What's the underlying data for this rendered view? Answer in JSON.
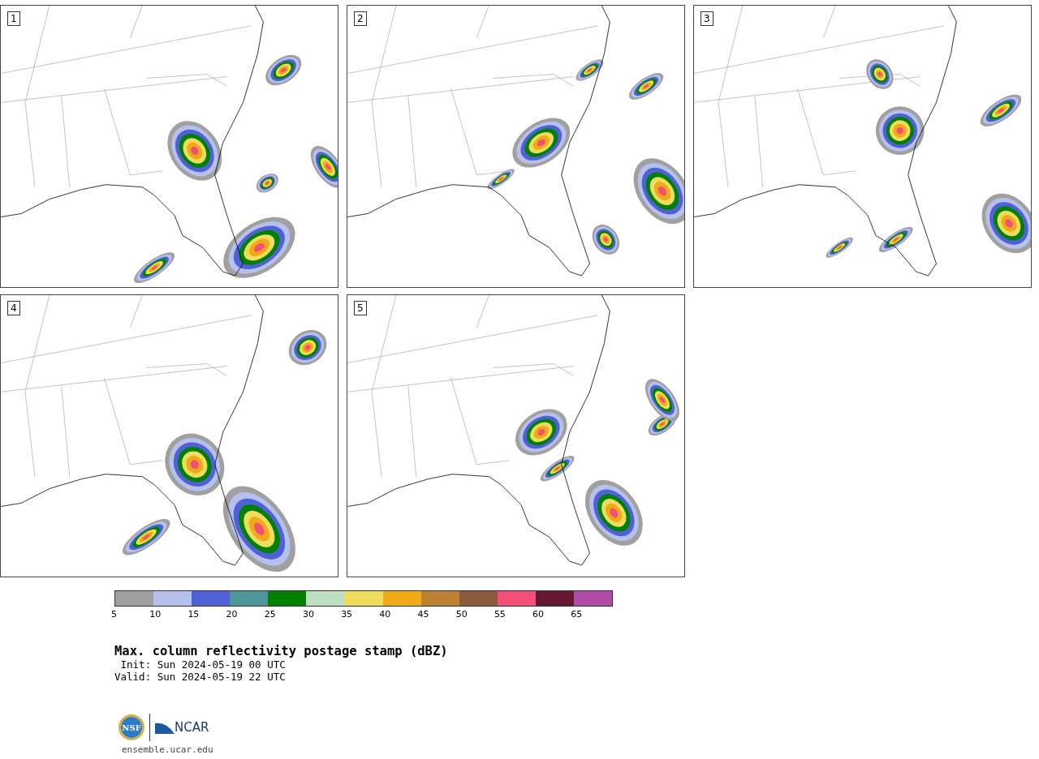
{
  "panels": [
    {
      "label": "1"
    },
    {
      "label": "2"
    },
    {
      "label": "3"
    },
    {
      "label": "4"
    },
    {
      "label": "5"
    }
  ],
  "colorbar": {
    "bins": [
      {
        "color": "#a0a0a0"
      },
      {
        "color": "#b6c0ec"
      },
      {
        "color": "#5060d6"
      },
      {
        "color": "#4f969b"
      },
      {
        "color": "#008000"
      },
      {
        "color": "#bedfbf"
      },
      {
        "color": "#f0dc5c"
      },
      {
        "color": "#f0aa18"
      },
      {
        "color": "#bc8030"
      },
      {
        "color": "#8c5a3c"
      },
      {
        "color": "#f25078"
      },
      {
        "color": "#641832"
      },
      {
        "color": "#b04ca6"
      }
    ],
    "ticks": [
      "5",
      "10",
      "15",
      "20",
      "25",
      "30",
      "35",
      "40",
      "45",
      "50",
      "55",
      "60",
      "65"
    ]
  },
  "title": "Max. column reflectivity postage stamp (dBZ)",
  "init": " Init: Sun 2024-05-19 00 UTC",
  "valid": "Valid: Sun 2024-05-19 22 UTC",
  "logos": {
    "nsf": "NSF",
    "ncar": "NCAR"
  },
  "site": "ensemble.ucar.edu"
}
